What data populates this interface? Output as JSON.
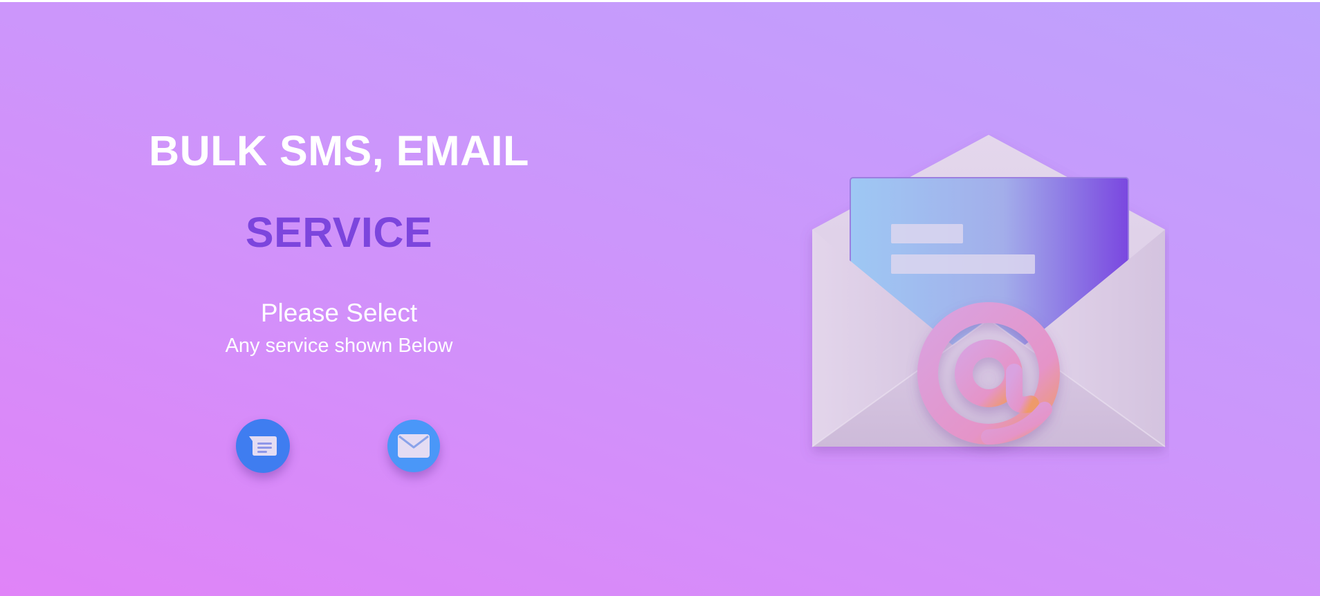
{
  "hero": {
    "title": "BULK SMS, EMAIL",
    "subtitle": "SERVICE",
    "prompt": "Please Select",
    "prompt_sub": "Any service shown Below"
  },
  "services": [
    {
      "id": "sms",
      "icon": "message-icon",
      "color": "#3f7df0"
    },
    {
      "id": "email",
      "icon": "mail-icon",
      "color": "#4a97f8"
    }
  ],
  "illustration": {
    "icon": "envelope-at-icon",
    "at_symbol": "@"
  },
  "colors": {
    "background_top": "#bea2fd",
    "background_bottom": "#e083f8",
    "accent": "#7c45dd"
  }
}
